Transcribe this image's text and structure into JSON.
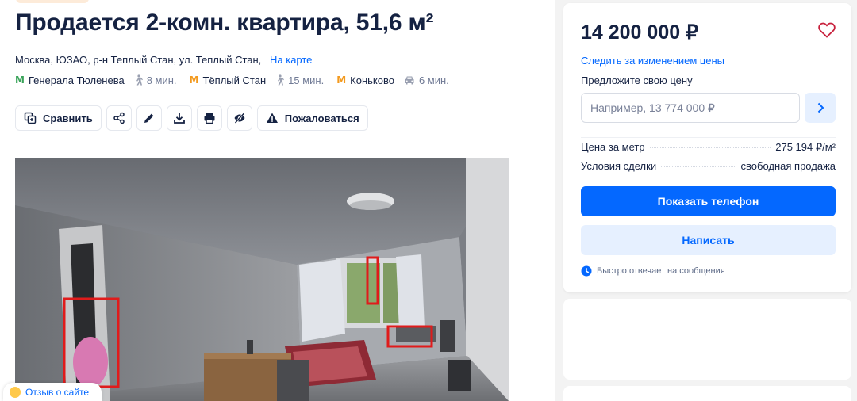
{
  "listing": {
    "title": "Продается 2-комн. квартира, 51,6 м²",
    "address": "Москва, ЮЗАО, р-н Теплый Стан, ул. Теплый Стан,",
    "map_link": "На карте",
    "metros": [
      {
        "logo": "M",
        "name": "Генерала Тюленева",
        "time": "8 мин.",
        "color": "#3aa35a",
        "mode": "walk-icon"
      },
      {
        "logo": "M",
        "name": "Тёплый Стан",
        "time": "15 мин.",
        "color": "#f39a1f",
        "mode": "walk-icon"
      },
      {
        "logo": "M",
        "name": "Коньково",
        "time": "6 мин.",
        "color": "#f39a1f",
        "mode": "car-icon"
      }
    ]
  },
  "toolbar": {
    "compare_label": "Сравнить",
    "report_label": "Пожаловаться",
    "icons": [
      "compare-icon",
      "share-icon",
      "edit-icon",
      "download-icon",
      "print-icon",
      "hide-icon",
      "warning-icon"
    ]
  },
  "feedback": {
    "label": "Отзыв о сайте"
  },
  "sidebar": {
    "price": "14 200 000 ₽",
    "follow_price": "Следить за изменением цены",
    "offer_label": "Предложите свою цену",
    "offer_placeholder": "Например, 13 774 000 ₽",
    "details": [
      {
        "label": "Цена за метр",
        "value": "275 194 ₽/м²"
      },
      {
        "label": "Условия сделки",
        "value": "свободная продажа"
      }
    ],
    "show_phone": "Показать телефон",
    "write": "Написать",
    "fast_reply": "Быстро отвечает на сообщения"
  },
  "colors": {
    "accent": "#0468ff",
    "accent_light": "#e6f0ff",
    "heart": "#c8213d"
  }
}
